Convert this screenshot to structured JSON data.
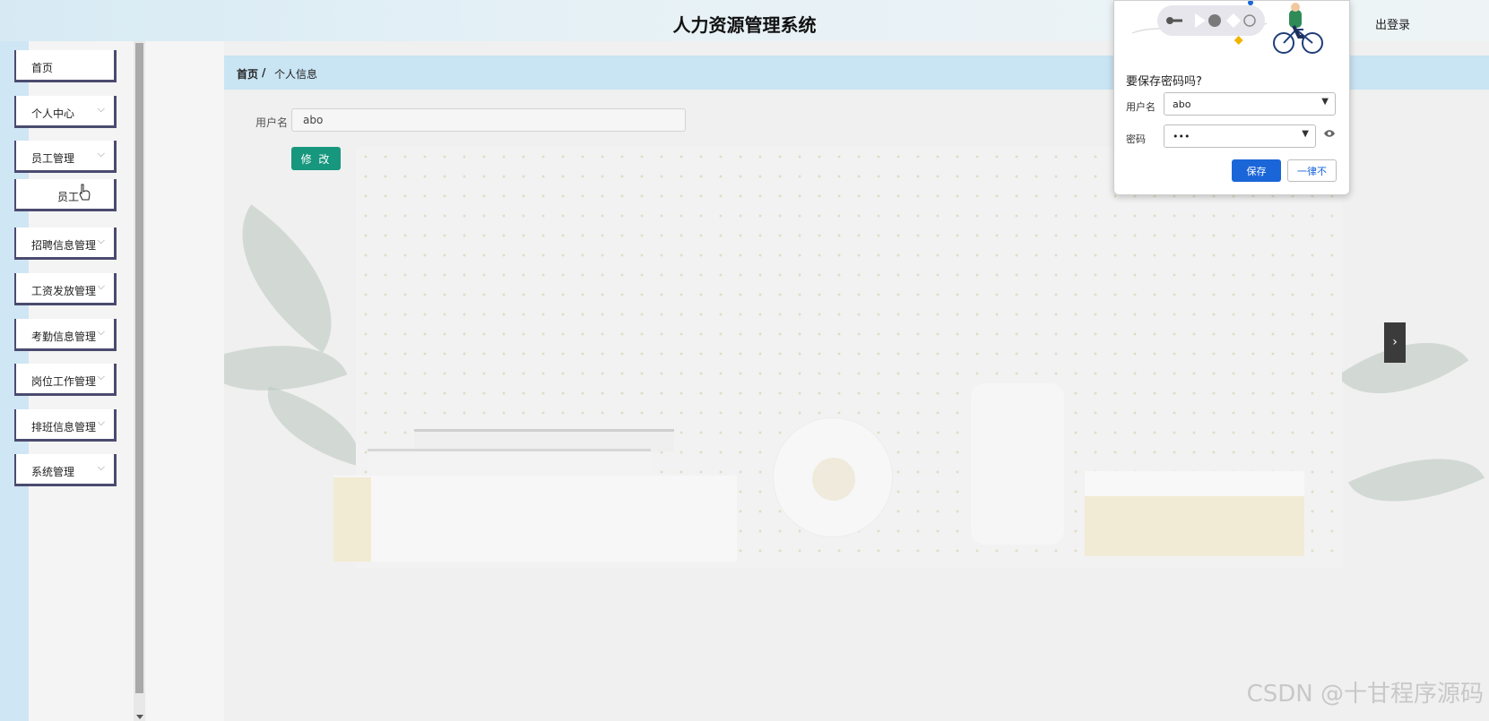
{
  "header": {
    "title": "人力资源管理系统",
    "logout_label": "出登录"
  },
  "sidebar": {
    "items": [
      {
        "label": "首页",
        "has_chevron": false
      },
      {
        "label": "个人中心",
        "has_chevron": true
      },
      {
        "label": "员工管理",
        "has_chevron": true
      },
      {
        "label": "员工",
        "has_chevron": false,
        "submenu": true
      },
      {
        "label": "招聘信息管理",
        "has_chevron": true
      },
      {
        "label": "工资发放管理",
        "has_chevron": true
      },
      {
        "label": "考勤信息管理",
        "has_chevron": true
      },
      {
        "label": "岗位工作管理",
        "has_chevron": true
      },
      {
        "label": "排班信息管理",
        "has_chevron": true
      },
      {
        "label": "系统管理",
        "has_chevron": true
      }
    ],
    "chevron": "⌵"
  },
  "breadcrumb": {
    "home": "首页",
    "separator": "/",
    "current": "个人信息"
  },
  "form": {
    "username_label": "用户名",
    "username_value": "abo",
    "modify_label": "修 改"
  },
  "password_popup": {
    "title": "要保存密码吗?",
    "username_label": "用户名",
    "username_value": "abo",
    "password_label": "密码",
    "password_value": "•••",
    "save_label": "保存",
    "never_label": "一律不"
  },
  "side_tab_icon": "›",
  "watermark": "CSDN @十甘程序源码",
  "colors": {
    "breadcrumb_bg": "#c9e4f3",
    "modify_button": "#17977d",
    "save_button": "#1a66d8",
    "menu_border": "#4b4b70"
  }
}
